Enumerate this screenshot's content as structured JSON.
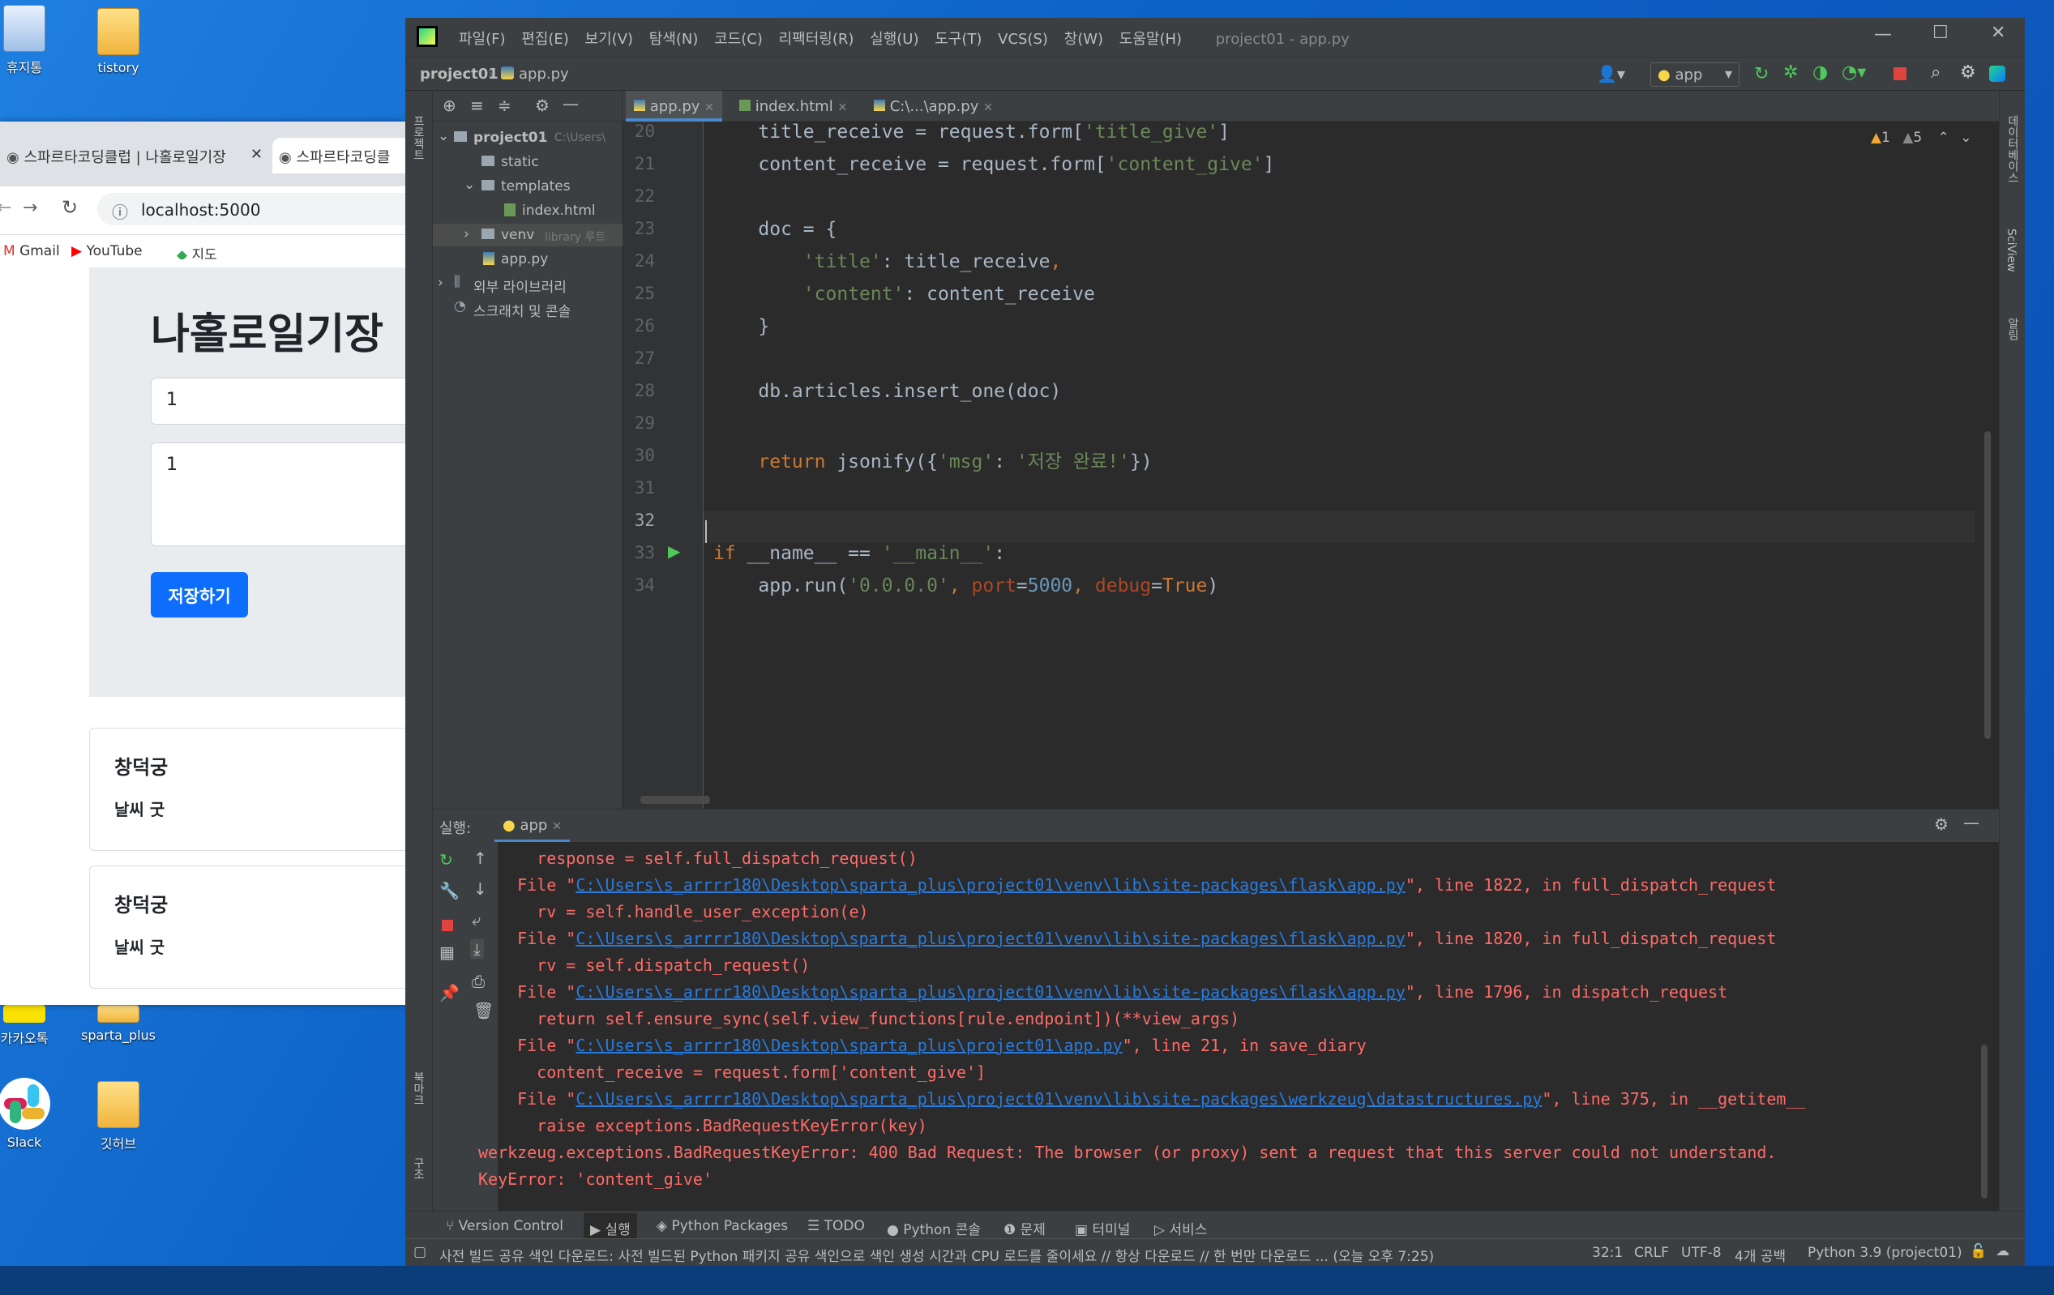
{
  "desktop": {
    "icons": [
      {
        "label": "휴지통"
      },
      {
        "label": "tistory"
      },
      {
        "label": "카카오톡"
      },
      {
        "label": "sparta_plus"
      },
      {
        "label": "Slack"
      },
      {
        "label": "깃허브"
      }
    ]
  },
  "browser": {
    "tabs": [
      {
        "title": "스파르타코딩클럽 | 나홀로일기장"
      },
      {
        "title": "스파르타코딩클"
      }
    ],
    "url": "localhost:5000",
    "bookmarks": [
      "Gmail",
      "YouTube",
      "지도"
    ],
    "page": {
      "title": "나홀로일기장",
      "title_input_value": "1",
      "content_input_value": "1",
      "save_button": "저장하기",
      "cards": [
        {
          "title": "창덕궁",
          "text": "날씨 굿"
        },
        {
          "title": "창덕궁",
          "text": "날씨 굿"
        }
      ]
    }
  },
  "ide": {
    "menu": [
      "파일(F)",
      "편집(E)",
      "보기(V)",
      "탐색(N)",
      "코드(C)",
      "리팩터링(R)",
      "실행(U)",
      "도구(T)",
      "VCS(S)",
      "창(W)",
      "도움말(H)"
    ],
    "window_title": "project01 - app.py",
    "breadcrumb": [
      "project01",
      "app.py"
    ],
    "run_config": "app",
    "left_strip_label": "프로젝트",
    "right_strip_labels": [
      "데이터베이스",
      "SciView",
      "알림"
    ],
    "project_tree": [
      {
        "label": "project01",
        "hint": "C:\\Users\\",
        "level": 0
      },
      {
        "label": "static",
        "hint": "",
        "level": 1
      },
      {
        "label": "templates",
        "hint": "",
        "level": 1
      },
      {
        "label": "index.html",
        "hint": "",
        "level": 2
      },
      {
        "label": "venv",
        "hint": "library 루트",
        "level": 1
      },
      {
        "label": "app.py",
        "hint": "",
        "level": 1
      },
      {
        "label": "외부 라이브러리",
        "hint": "",
        "level": 0
      },
      {
        "label": "스크래치 및 콘솔",
        "hint": "",
        "level": 0
      }
    ],
    "editor_tabs": [
      "app.py",
      "index.html",
      "C:\\...\\app.py"
    ],
    "inspections": {
      "warnings": "1",
      "weak_warnings": "5"
    },
    "line_numbers": [
      "20",
      "21",
      "22",
      "23",
      "24",
      "25",
      "26",
      "27",
      "28",
      "29",
      "30",
      "31",
      "32",
      "33",
      "34"
    ],
    "run_panel": {
      "label": "실행:",
      "tab": "app",
      "console": [
        "    response = self.full_dispatch_request()",
        "  File \"",
        "C:\\Users\\s_arrrr180\\Desktop\\sparta_plus\\project01\\venv\\lib\\site-packages\\flask\\app.py",
        "\", line 1822, in full_dispatch_request",
        "    rv = self.handle_user_exception(e)",
        "\", line 1820, in full_dispatch_request",
        "    rv = self.dispatch_request()",
        "\", line 1796, in dispatch_request",
        "    return self.ensure_sync(self.view_functions[rule.endpoint])(**view_args)",
        "C:\\Users\\s_arrrr180\\Desktop\\sparta_plus\\project01\\app.py",
        "\", line 21, in save_diary",
        "    content_receive = request.form['content_give']",
        "C:\\Users\\s_arrrr180\\Desktop\\sparta_plus\\project01\\venv\\lib\\site-packages\\werkzeug\\datastructures.py",
        "\", line 375, in __getitem__",
        "    raise exceptions.BadRequestKeyError(key)",
        "werkzeug.exceptions.BadRequestKeyError: 400 Bad Request: The browser (or proxy) sent a request that this server could not understand.",
        "KeyError: 'content_give'"
      ]
    },
    "bottom_tabs": [
      "Version Control",
      "실행",
      "Python Packages",
      "TODO",
      "Python 콘솔",
      "문제",
      "터미널",
      "서비스"
    ],
    "side_labels": [
      "북마크",
      "구조"
    ],
    "status": {
      "message": "사전 빌드 공유 색인 다운로드: 사전 빌드된 Python 패키지 공유 색인으로 색인 생성 시간과 CPU 로드를 줄이세요 // 항상 다운로드 // 한 번만 다운로드 ... (오늘 오후 7:25)",
      "position": "32:1",
      "line_sep": "CRLF",
      "encoding": "UTF-8",
      "indent": "4개 공백",
      "interpreter": "Python 3.9 (project01)"
    }
  }
}
